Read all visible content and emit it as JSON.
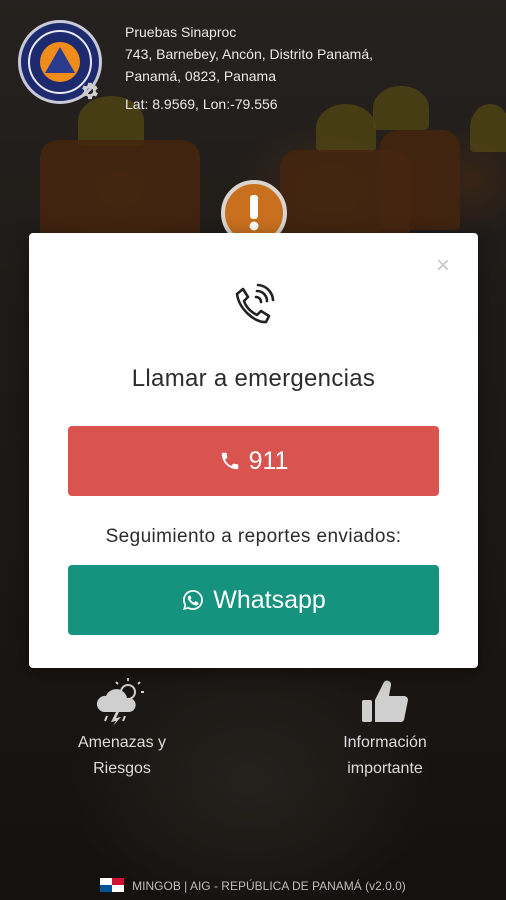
{
  "header": {
    "name": "Pruebas Sinaproc",
    "address_line1": "743, Barnebey, Ancón, Distrito Panamá,",
    "address_line2": "Panamá, 0823, Panama",
    "coords": "Lat: 8.9569, Lon:-79.556"
  },
  "modal": {
    "title": "Llamar a emergencias",
    "call_button_label": "911",
    "tracking_label": "Seguimiento a reportes enviados:",
    "whatsapp_button_label": "Whatsapp",
    "close_symbol": "×"
  },
  "menu": {
    "item1_line1": "Amenazas y",
    "item1_line2": "Riesgos",
    "item2_line1": "Información",
    "item2_line2": "importante"
  },
  "footer": {
    "text": "MINGOB | AIG - REPÚBLICA DE PANAMÁ (v2.0.0)"
  },
  "colors": {
    "call_button": "#d9534f",
    "whatsapp_button": "#16937e",
    "alert": "#c8701e"
  },
  "icons": [
    "settings-gear-icon",
    "alert-icon",
    "phone-ringing-icon",
    "phone-icon",
    "whatsapp-icon",
    "weather-storm-icon",
    "thumbs-up-icon",
    "panama-flag-icon"
  ]
}
